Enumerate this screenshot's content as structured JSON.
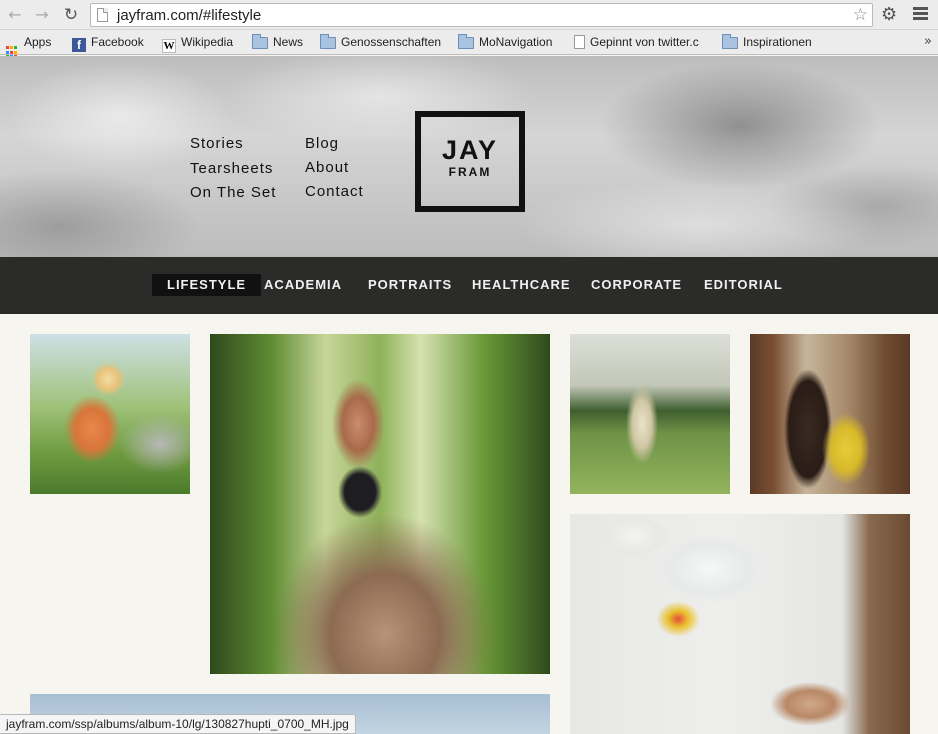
{
  "browser": {
    "url": "jayfram.com/#lifestyle",
    "bookmarks": [
      {
        "label": "Apps",
        "icon": "apps-grid-icon"
      },
      {
        "label": "Facebook",
        "icon": "facebook-icon"
      },
      {
        "label": "Wikipedia",
        "icon": "wikipedia-icon"
      },
      {
        "label": "News",
        "icon": "folder-icon"
      },
      {
        "label": "Genossenschaften",
        "icon": "folder-icon"
      },
      {
        "label": "MoNavigation",
        "icon": "folder-icon"
      },
      {
        "label": "Gepinnt von twitter.c",
        "icon": "page-icon"
      },
      {
        "label": "Inspirationen",
        "icon": "folder-icon"
      }
    ],
    "more_symbol": "»",
    "status_url": "jayfram.com/ssp/albums/album-10/lg/130827hupti_0700_MH.jpg"
  },
  "site": {
    "logo": {
      "line1": "JAY",
      "line2": "FRAM"
    },
    "nav_left": [
      "Stories",
      "Tearsheets",
      "On The Set"
    ],
    "nav_right": [
      "Blog",
      "About",
      "Contact"
    ],
    "categories": [
      "LIFESTYLE",
      "ACADEMIA",
      "PORTRAITS",
      "HEALTHCARE",
      "CORPORATE",
      "EDITORIAL"
    ],
    "active_category": "LIFESTYLE"
  },
  "colors": {
    "category_bar": "#2b2b2a",
    "active_tab": "#111111",
    "page_background": "#f6f5f0"
  }
}
